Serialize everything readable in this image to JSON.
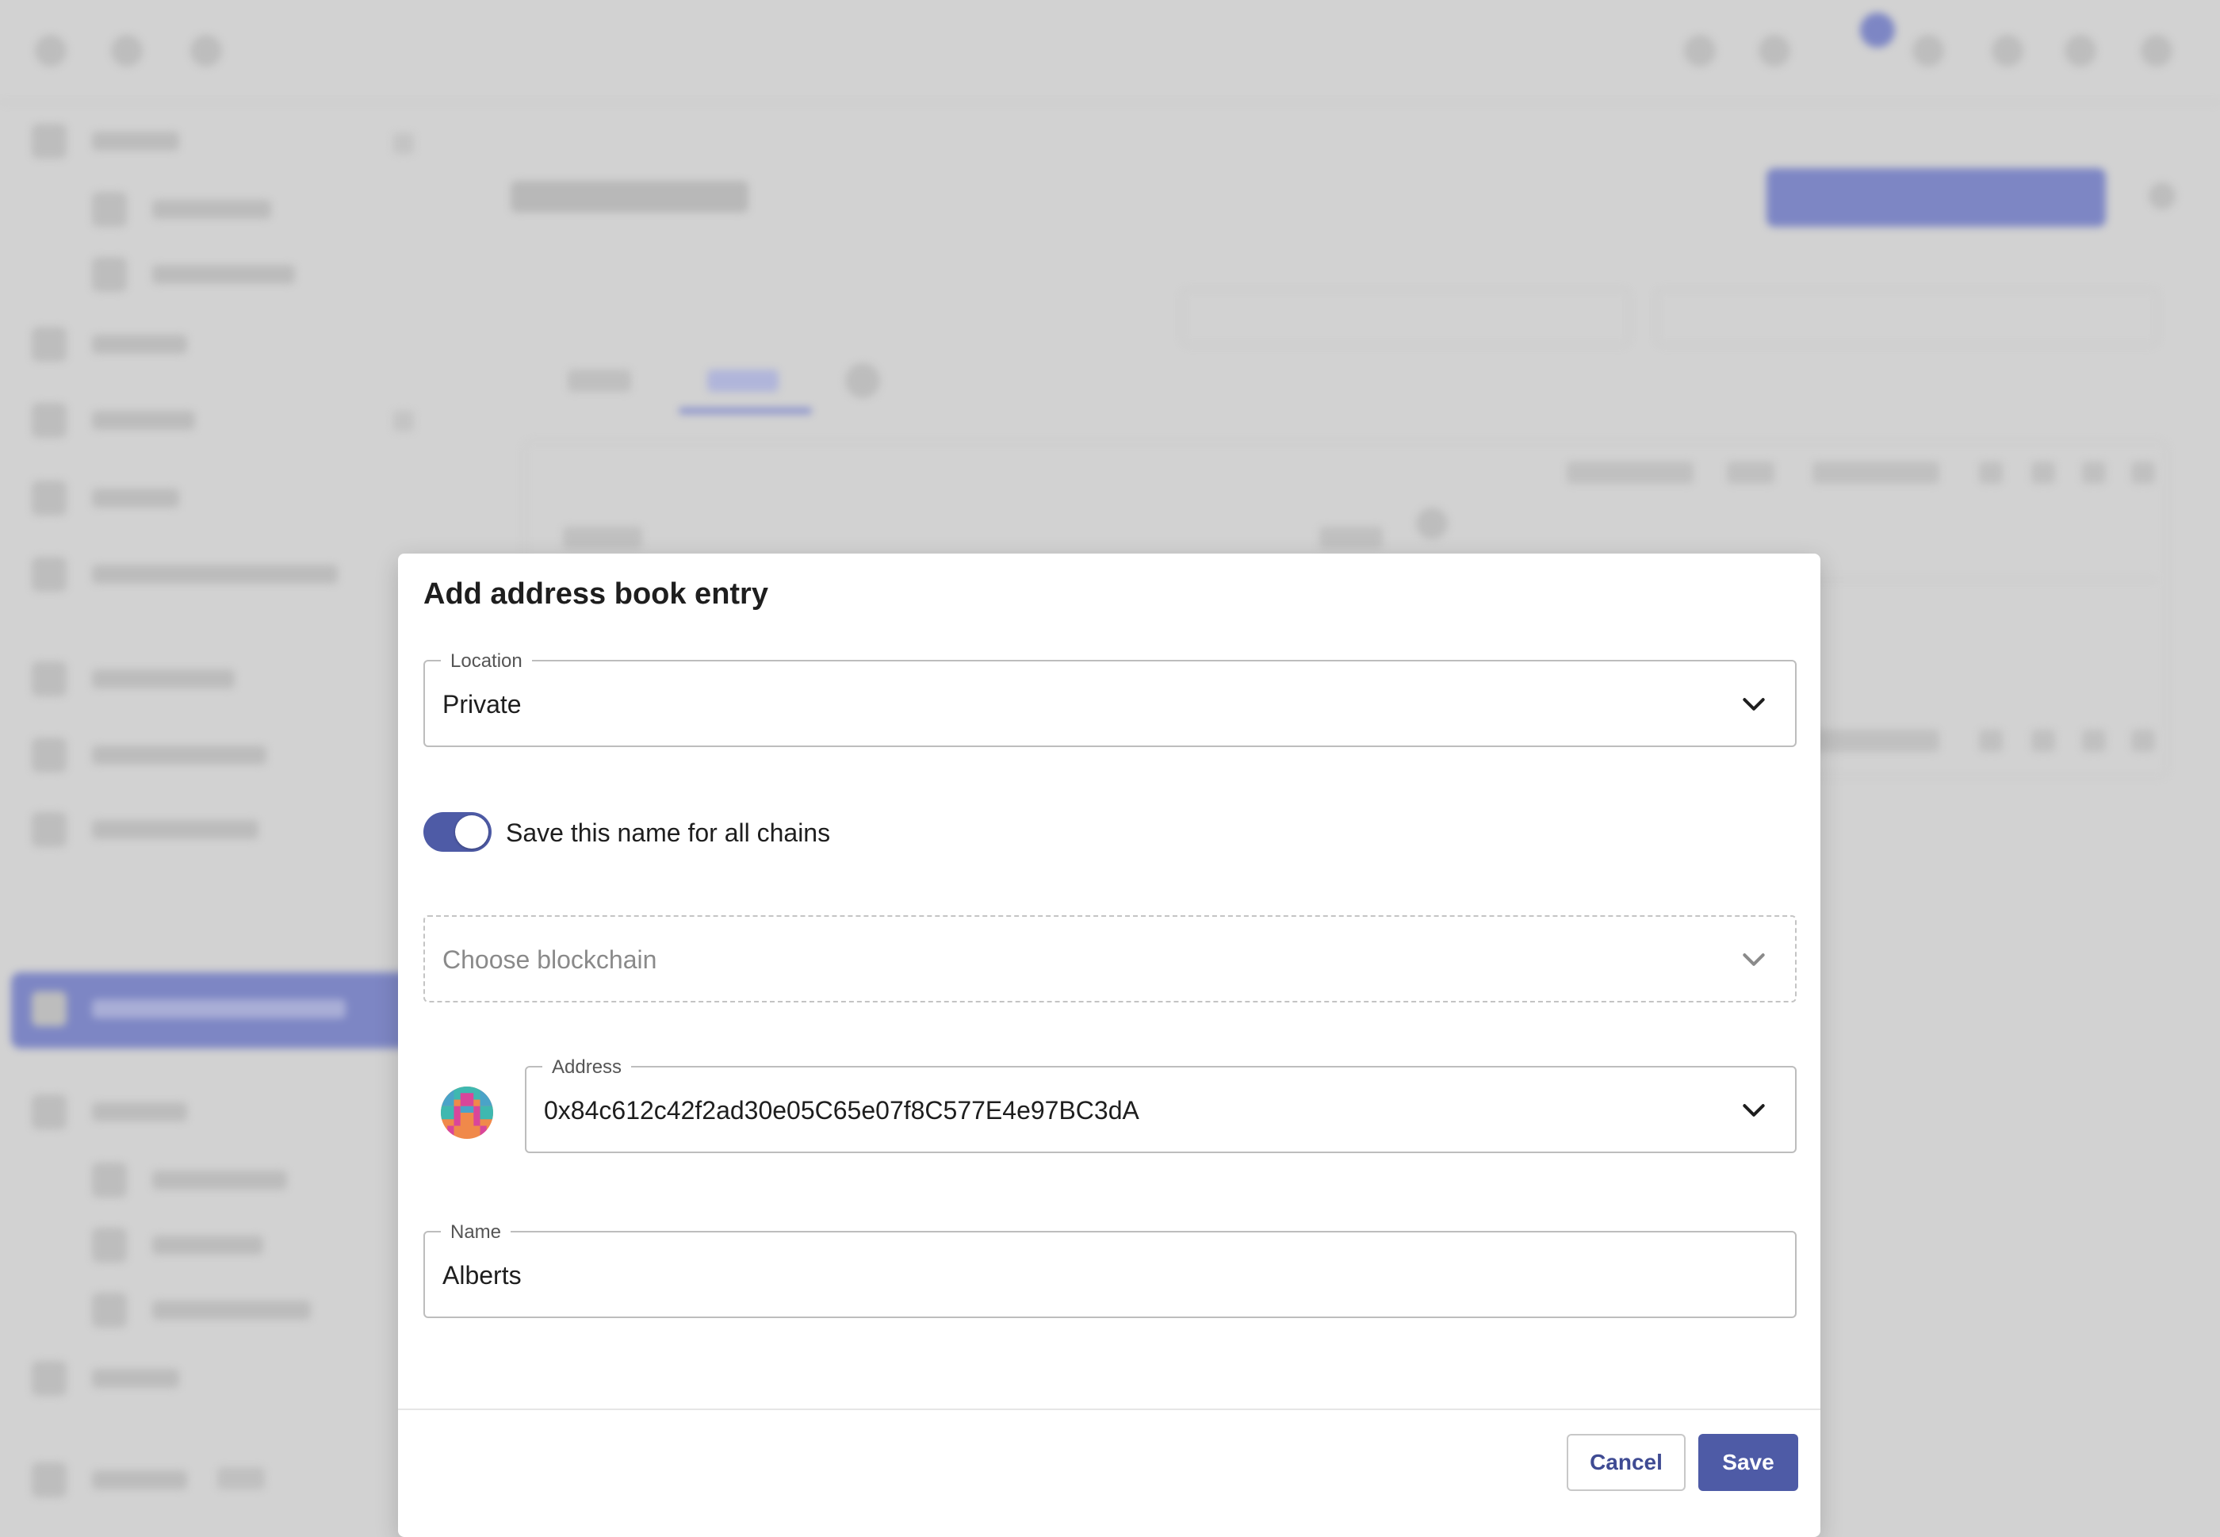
{
  "dialog": {
    "title": "Add address book entry",
    "location": {
      "label": "Location",
      "value": "Private"
    },
    "save_for_all_chains": {
      "label": "Save this name for all chains",
      "enabled": true
    },
    "blockchain": {
      "placeholder": "Choose blockchain"
    },
    "address": {
      "label": "Address",
      "value": "0x84c612c42f2ad30e05C65e07f8C577E4e97BC3dA"
    },
    "name": {
      "label": "Name",
      "value": "Alberts"
    },
    "cancel_label": "Cancel",
    "save_label": "Save"
  },
  "colors": {
    "accent": "#4e5ba6",
    "overlay": "#d2d2d2"
  },
  "icons": {
    "dropdown": "chevron-down-icon",
    "avatar": "blockie-avatar"
  }
}
